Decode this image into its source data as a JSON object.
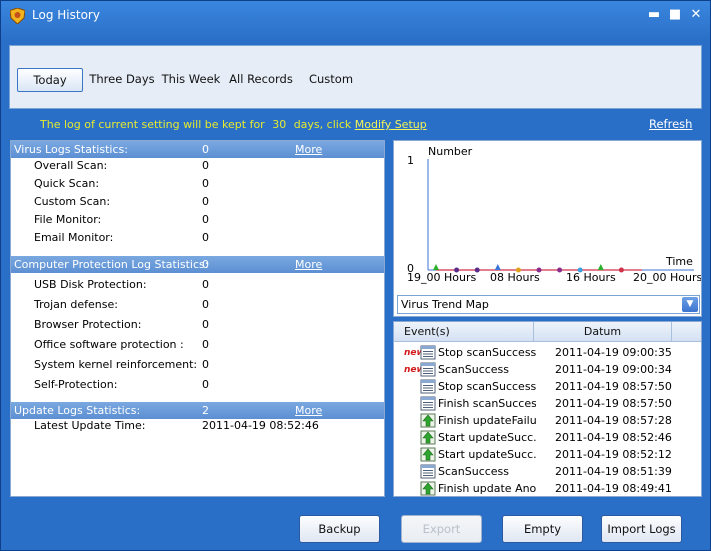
{
  "window": {
    "title": "Log History",
    "minimize": "▬",
    "maximize": "■",
    "close": "✕"
  },
  "tabs": [
    {
      "label": "Today",
      "active": true
    },
    {
      "label": "Three Days",
      "active": false
    },
    {
      "label": "This Week",
      "active": false
    },
    {
      "label": "All Records",
      "active": false
    },
    {
      "label": "Custom",
      "active": false
    }
  ],
  "notice": {
    "prefix": "The log of current setting will be kept for",
    "days": "30",
    "suffix": "days, click",
    "link": "Modify Setup"
  },
  "refresh_label": "Refresh",
  "virus_stats": {
    "header": "Virus Logs Statistics:",
    "value": "0",
    "more": "More Information",
    "rows": [
      {
        "label": "Overall Scan:",
        "value": "0"
      },
      {
        "label": "Quick Scan:",
        "value": "0"
      },
      {
        "label": "Custom Scan:",
        "value": "0"
      },
      {
        "label": "File Monitor:",
        "value": "0"
      },
      {
        "label": "Email Monitor:",
        "value": "0"
      }
    ]
  },
  "protection_stats": {
    "header": "Computer Protection Log Statistics:",
    "value": "0",
    "more": "More Information",
    "rows": [
      {
        "label": "USB Disk Protection:",
        "value": "0"
      },
      {
        "label": "Trojan defense:",
        "value": "0"
      },
      {
        "label": "Browser Protection:",
        "value": "0"
      },
      {
        "label": "Office software protection :",
        "value": "0"
      },
      {
        "label": "System kernel reinforcement:",
        "value": "0"
      },
      {
        "label": "Self-Protection:",
        "value": "0"
      }
    ]
  },
  "update_stats": {
    "header": "Update Logs Statistics:",
    "value": "2",
    "more": "More Information",
    "rows": [
      {
        "label": "Latest Update Time:",
        "value": "2011-04-19 08:52:46"
      }
    ]
  },
  "chart_data": {
    "type": "line",
    "ylabel": "Number",
    "xlabel": "Time",
    "y_ticks": [
      "1",
      "0"
    ],
    "ylim": [
      0,
      1
    ],
    "x_ticks": [
      "19_00 Hours",
      "08 Hours",
      "16 Hours",
      "20_00 Hours"
    ],
    "series": [
      {
        "values": [
          0,
          0,
          0,
          0,
          0,
          0,
          0,
          0,
          0,
          0,
          0
        ],
        "color": "#d0304a"
      }
    ],
    "marker_colors": [
      "#2bb02b",
      "#5a2d8a",
      "#5a2d8a",
      "#3a73d6",
      "#e0a020",
      "#8a2d8a",
      "#8a2d8a",
      "#3aa0e0",
      "#2bb02b",
      "#d0304a"
    ]
  },
  "trend_select": {
    "value": "Virus Trend Map"
  },
  "events": {
    "headers": [
      "Event(s)",
      "Datum"
    ],
    "rows": [
      {
        "new": "new",
        "icon": "log-icon",
        "name": "Stop scanSuccess",
        "date": "2011-04-19 09:00:35"
      },
      {
        "new": "new",
        "icon": "log-icon",
        "name": "ScanSuccess",
        "date": "2011-04-19 09:00:34"
      },
      {
        "new": "",
        "icon": "log-icon",
        "name": "Stop scanSuccess",
        "date": "2011-04-19 08:57:50"
      },
      {
        "new": "",
        "icon": "log-icon",
        "name": "Finish scanSuccess",
        "date": "2011-04-19 08:57:50"
      },
      {
        "new": "",
        "icon": "update-icon",
        "name": "Finish updateFailu...",
        "date": "2011-04-19 08:57:28"
      },
      {
        "new": "",
        "icon": "update-icon",
        "name": "Start updateSucc...",
        "date": "2011-04-19 08:52:46"
      },
      {
        "new": "",
        "icon": "update-icon",
        "name": "Start updateSucc...",
        "date": "2011-04-19 08:52:12"
      },
      {
        "new": "",
        "icon": "log-icon",
        "name": "ScanSuccess",
        "date": "2011-04-19 08:51:39"
      },
      {
        "new": "",
        "icon": "update-icon",
        "name": "Finish update Ano...",
        "date": "2011-04-19 08:49:41"
      }
    ]
  },
  "buttons": {
    "backup": "Backup",
    "export": "Export",
    "empty": "Empty",
    "import": "Import Logs"
  },
  "colors": {
    "window_blue": "#2a6fc7",
    "notice_yellow": "#e5ea2e",
    "new_red": "#d31a1a"
  }
}
